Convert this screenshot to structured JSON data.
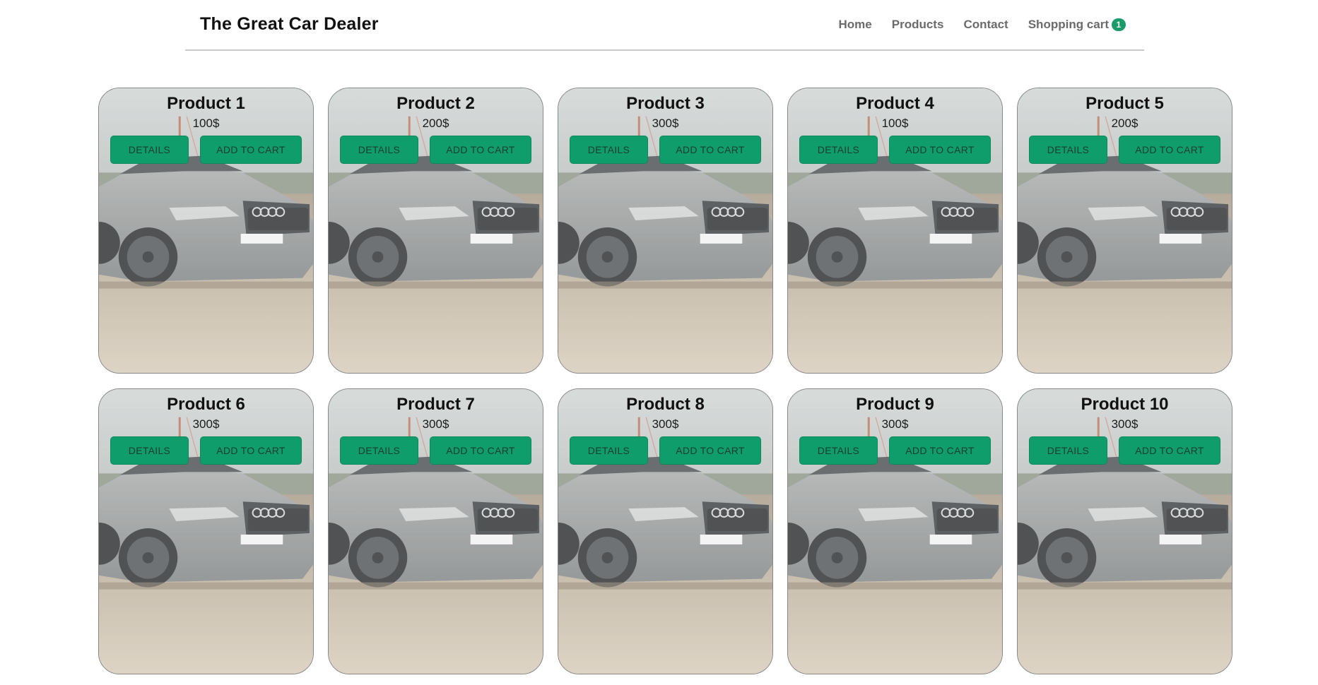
{
  "header": {
    "brand": "The Great Car Dealer",
    "nav": [
      {
        "label": "Home"
      },
      {
        "label": "Products"
      },
      {
        "label": "Contact"
      },
      {
        "label": "Shopping cart",
        "badge": "1"
      }
    ]
  },
  "colors": {
    "accent": "#0f9d6c",
    "badge": "#1a9b6c"
  },
  "products": [
    {
      "title": "Product 1",
      "price": "100$",
      "details_label": "DETAILS",
      "cart_label": "ADD TO CART",
      "image_icon": "car-photo"
    },
    {
      "title": "Product 2",
      "price": "200$",
      "details_label": "DETAILS",
      "cart_label": "ADD TO CART",
      "image_icon": "car-photo"
    },
    {
      "title": "Product 3",
      "price": "300$",
      "details_label": "DETAILS",
      "cart_label": "ADD TO CART",
      "image_icon": "car-photo"
    },
    {
      "title": "Product 4",
      "price": "100$",
      "details_label": "DETAILS",
      "cart_label": "ADD TO CART",
      "image_icon": "car-photo"
    },
    {
      "title": "Product 5",
      "price": "200$",
      "details_label": "DETAILS",
      "cart_label": "ADD TO CART",
      "image_icon": "car-photo"
    },
    {
      "title": "Product 6",
      "price": "300$",
      "details_label": "DETAILS",
      "cart_label": "ADD TO CART",
      "image_icon": "car-photo"
    },
    {
      "title": "Product 7",
      "price": "300$",
      "details_label": "DETAILS",
      "cart_label": "ADD TO CART",
      "image_icon": "car-photo"
    },
    {
      "title": "Product 8",
      "price": "300$",
      "details_label": "DETAILS",
      "cart_label": "ADD TO CART",
      "image_icon": "car-photo"
    },
    {
      "title": "Product 9",
      "price": "300$",
      "details_label": "DETAILS",
      "cart_label": "ADD TO CART",
      "image_icon": "car-photo"
    },
    {
      "title": "Product 10",
      "price": "300$",
      "details_label": "DETAILS",
      "cart_label": "ADD TO CART",
      "image_icon": "car-photo"
    }
  ]
}
